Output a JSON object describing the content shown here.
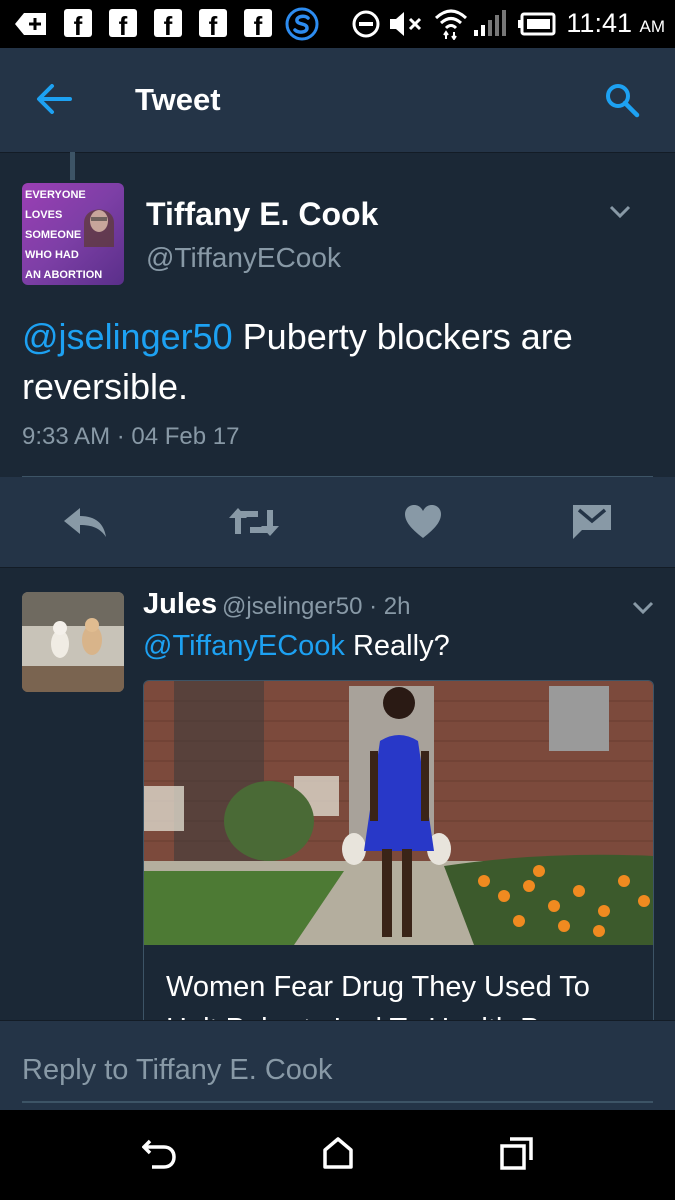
{
  "status_bar": {
    "time": "11:41",
    "ampm": "AM",
    "notif_icons": [
      "add-box-icon",
      "facebook-icon",
      "facebook-icon",
      "facebook-icon",
      "facebook-icon",
      "facebook-icon",
      "s-app-icon"
    ],
    "system_icons": [
      "do-not-disturb-icon",
      "mute-icon",
      "wifi-icon",
      "signal-icon",
      "battery-icon"
    ]
  },
  "app_bar": {
    "title": "Tweet"
  },
  "tweet": {
    "name": "Tiffany E. Cook",
    "handle": "@TiffanyECook",
    "avatar_text": [
      "EVERYONE",
      "LOVES",
      "SOMEONE",
      "WHO HAD",
      "AN ABORTION"
    ],
    "mention": "@jselinger50",
    "text": " Puberty blockers are reversible.",
    "timestamp": "9:33 AM · 04 Feb 17"
  },
  "actions": [
    "reply-icon",
    "retweet-icon",
    "like-icon",
    "direct-message-icon"
  ],
  "reply": {
    "name": "Jules",
    "meta": "@jselinger50 · 2h",
    "mention": "@TiffanyECook",
    "text": " Really?",
    "card_title": "Women Fear Drug They Used To Halt Puberty Led To Health Pr..."
  },
  "reply_bar": {
    "placeholder": "Reply to Tiffany E. Cook"
  },
  "colors": {
    "background": "#1b2836",
    "bar": "#243447",
    "accent": "#1da1f2",
    "muted": "#8899a6"
  }
}
